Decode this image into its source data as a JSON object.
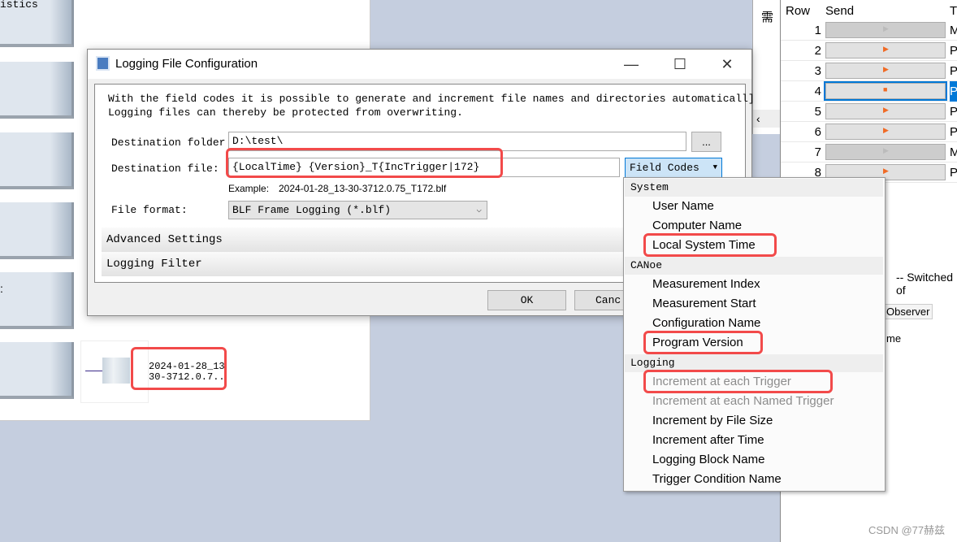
{
  "background_panel": {
    "tile_label": "istics",
    "file_block": {
      "line1": "2024-01-28_13",
      "line2": "30-3712.0.7.."
    },
    "partial_label": ":"
  },
  "dialog": {
    "title": "Logging File Configuration",
    "description": [
      "With the field codes it is possible to generate and increment file names and directories automaticall]",
      "Logging files can thereby be protected from overwriting."
    ],
    "destination_folder_label": "Destination folder",
    "destination_folder_value": "D:\\test\\",
    "browse_label": "...",
    "destination_file_label": "Destination file:",
    "destination_file_value": "{LocalTime} {Version}_T{IncTrigger|172}",
    "field_codes_label": "Field Codes",
    "example_label": "Example:",
    "example_value": "2024-01-28_13-30-3712.0.75_T172.blf",
    "file_format_label": "File format:",
    "file_format_value": "BLF Frame Logging (*.blf)",
    "advanced_settings": "Advanced Settings",
    "logging_filter": "Logging Filter",
    "ok_label": "OK",
    "cancel_label": "Canc"
  },
  "field_codes_menu": {
    "groups": [
      {
        "header": "System",
        "items": [
          {
            "label": "User Name"
          },
          {
            "label": "Computer Name"
          },
          {
            "label": "Local System Time",
            "highlighted": true
          }
        ]
      },
      {
        "header": "CANoe",
        "items": [
          {
            "label": "Measurement Index"
          },
          {
            "label": "Measurement Start"
          },
          {
            "label": "Configuration Name"
          },
          {
            "label": "Program Version",
            "highlighted": true
          }
        ]
      },
      {
        "header": "Logging",
        "items": [
          {
            "label": "Increment at each Trigger",
            "disabled": true,
            "highlighted": true
          },
          {
            "label": "Increment at each Named Trigger",
            "disabled": true
          },
          {
            "label": "Increment by File Size"
          },
          {
            "label": "Increment after Time"
          },
          {
            "label": "Logging Block Name"
          },
          {
            "label": "Trigger Condition Name"
          }
        ]
      }
    ]
  },
  "middle_window": {
    "char": "需"
  },
  "right_table": {
    "headers": [
      "Row",
      "Send",
      "T"
    ],
    "rows": [
      {
        "row": "1",
        "type": "M",
        "state": "disabled"
      },
      {
        "row": "2",
        "type": "P",
        "state": "play"
      },
      {
        "row": "3",
        "type": "P",
        "state": "play"
      },
      {
        "row": "4",
        "type": "P",
        "state": "stop",
        "selected": true
      },
      {
        "row": "5",
        "type": "P",
        "state": "play"
      },
      {
        "row": "6",
        "type": "P",
        "state": "play"
      },
      {
        "row": "7",
        "type": "M",
        "state": "disabled"
      },
      {
        "row": "8",
        "type": "P",
        "state": "play"
      }
    ],
    "status_text": "-- Switched of",
    "tab_observer": "Observer",
    "column_name": "me"
  },
  "watermark": "CSDN @77赫兹",
  "colors": {
    "highlight_red": "#f24a4a",
    "selection_blue": "#0078d7",
    "field_codes_bg": "#cce4f7",
    "play_orange": "#f06a25"
  }
}
